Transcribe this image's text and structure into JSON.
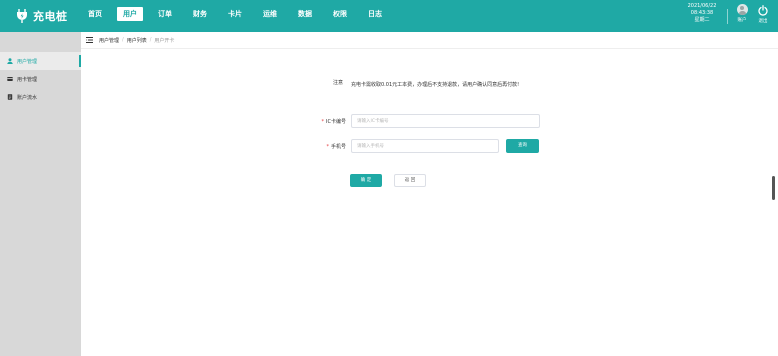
{
  "app": {
    "logo_text": "充电桩",
    "logo_icon": "charging-plug-icon"
  },
  "nav": {
    "items": [
      {
        "label": "首页",
        "active": false
      },
      {
        "label": "用户",
        "active": true
      },
      {
        "label": "订单",
        "active": false
      },
      {
        "label": "财务",
        "active": false
      },
      {
        "label": "卡片",
        "active": false
      },
      {
        "label": "运维",
        "active": false
      },
      {
        "label": "数据",
        "active": false
      },
      {
        "label": "权限",
        "active": false
      },
      {
        "label": "日志",
        "active": false
      }
    ]
  },
  "header": {
    "date": "2021/06/22",
    "time": "08:43:38",
    "weekday": "星期二",
    "profile_label": "账户",
    "logout_label": "退出"
  },
  "sidebar": {
    "items": [
      {
        "label": "用户管理",
        "icon": "user-icon",
        "active": true
      },
      {
        "label": "用卡管理",
        "icon": "card-icon",
        "active": false
      },
      {
        "label": "账户流水",
        "icon": "ledger-icon",
        "active": false
      }
    ]
  },
  "breadcrumb": {
    "items": [
      "用户管理",
      "用户列表",
      "用户开卡"
    ]
  },
  "form": {
    "notice_label": "注意",
    "notice_text": "充电卡需收取0.01元工本费，办理后不支持退款，请用户确认同意后再付款!",
    "card_label": "IC卡编号",
    "card_placeholder": "请输入IC卡编号",
    "card_value": "",
    "phone_label": "手机号",
    "phone_placeholder": "请输入手机号",
    "phone_value": "",
    "search_label": "查询",
    "confirm_label": "确 定",
    "back_label": "返 回"
  },
  "colors": {
    "accent": "#1fa9a5",
    "required": "#e4393c",
    "sidebar_bg": "#d8d8d8"
  }
}
